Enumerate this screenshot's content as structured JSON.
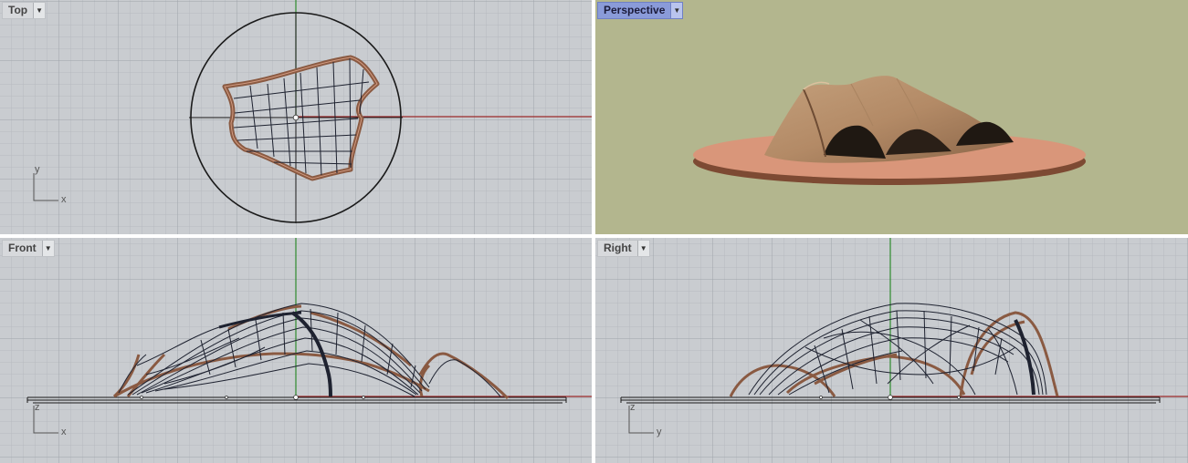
{
  "viewports": {
    "top": {
      "label": "Top",
      "axis_v": "y",
      "axis_h": "x"
    },
    "perspective": {
      "label": "Perspective"
    },
    "front": {
      "label": "Front",
      "axis_v": "z",
      "axis_h": "x"
    },
    "right": {
      "label": "Right",
      "axis_v": "z",
      "axis_h": "y"
    }
  },
  "icons": {
    "viewport_menu": "chevron-down-icon"
  },
  "colors": {
    "grid_bg": "#c9ccd0",
    "grid_minor": "#b5b9be",
    "grid_major": "#9fa4aa",
    "x_axis": "#9b2a2a",
    "y_axis": "#2e8b2e",
    "wood": "#8a5a42",
    "wireframe": "#1e2230",
    "persp_bg": "#b3b68e",
    "ground_disc": "#d9967a",
    "active_label": "#8a9bd9"
  }
}
